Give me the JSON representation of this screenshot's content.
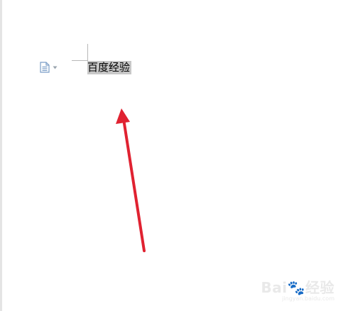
{
  "document": {
    "selected_text": "百度经验"
  },
  "paste_options": {
    "icon": "paste-options-icon",
    "dropdown_icon": "caret-down-icon"
  },
  "annotation": {
    "type": "arrow",
    "color": "#e02231"
  },
  "watermark": {
    "brand": "Bai\u0000经验",
    "url": "jingyan.baidu.com"
  },
  "colors": {
    "selection_highlight": "#c8c8c8",
    "margin_mark": "#b8b8b8",
    "icon_blue": "#7a9cc6"
  }
}
